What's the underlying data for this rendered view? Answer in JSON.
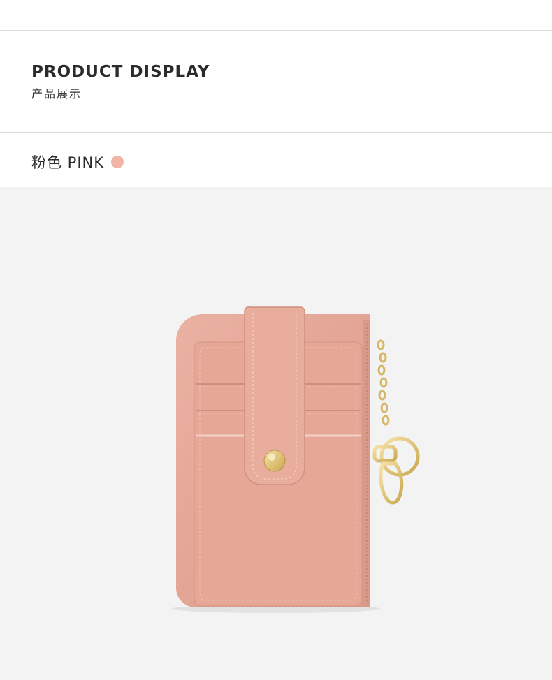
{
  "header": {
    "title": "PRODUCT DISPLAY",
    "subtitle": "产品展示"
  },
  "variant": {
    "label": "粉色 PINK",
    "swatch_color": "#f0b5a4"
  },
  "product_image": {
    "icon": "card-holder-wallet",
    "leather_color": "#e8a898",
    "hardware_color": "#e3c77a"
  }
}
